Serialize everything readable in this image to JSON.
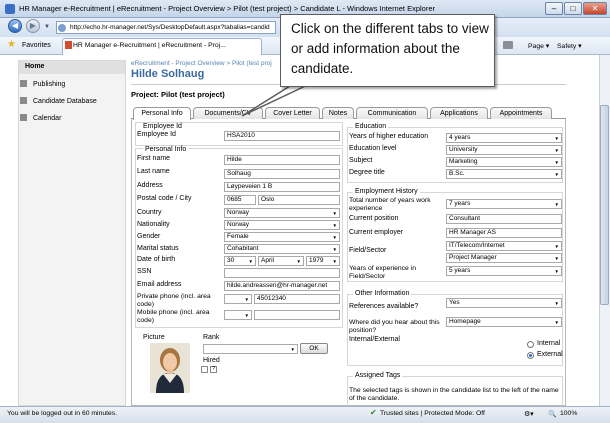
{
  "window": {
    "title": "HR Manager e-Recruitment | eRecruitment - Project Overview > Pilot (test project) > Candidate L - Windows Internet Explorer",
    "minimize": "–",
    "maximize": "□",
    "close": "✕"
  },
  "browser": {
    "url": "http://echo.hr-manager.net/Sys/DesktopDefault.aspx?tabalias=candid",
    "favorites_label": "Favorites",
    "tab_title": "HR Manager e-Recruitment | eRecruitment - Proj...",
    "page_menu": "Page ▾",
    "safety_menu": "Safety ▾"
  },
  "sidebar": {
    "items": [
      {
        "label": "Home"
      },
      {
        "label": "Publishing"
      },
      {
        "label": "Candidate Database"
      },
      {
        "label": "Calendar"
      }
    ]
  },
  "page": {
    "breadcrumb": "eRecruitment - Project Overview > Pilot (test proj",
    "candidate_name": "Hilde Solhaug",
    "project_label": "Project: Pilot (test project)"
  },
  "tabs": [
    {
      "label": "Personal Info",
      "active": true
    },
    {
      "label": "Documents/CV",
      "active": false
    },
    {
      "label": "Cover Letter",
      "active": false
    },
    {
      "label": "Notes",
      "active": false
    },
    {
      "label": "Communication",
      "active": false
    },
    {
      "label": "Applications",
      "active": false
    },
    {
      "label": "Appointments",
      "active": false
    }
  ],
  "form": {
    "employee_id": {
      "section": "Employee Id",
      "label": "Employee Id",
      "value": "HSA2010"
    },
    "personal": {
      "section": "Personal Info",
      "first_name": {
        "label": "First name",
        "value": "Hilde"
      },
      "last_name": {
        "label": "Last name",
        "value": "Solhaug"
      },
      "address": {
        "label": "Address",
        "value": "Løypeveien 1 B"
      },
      "postal": {
        "label": "Postal code / City",
        "code": "0685",
        "city": "Oslo"
      },
      "country": {
        "label": "Country",
        "value": "Norway"
      },
      "nationality": {
        "label": "Nationality",
        "value": "Norway"
      },
      "gender": {
        "label": "Gender",
        "value": "Female"
      },
      "marital": {
        "label": "Marital status",
        "value": "Cohabitant"
      },
      "dob": {
        "label": "Date of birth",
        "day": "30",
        "month": "April",
        "year": "1979"
      },
      "ssn": {
        "label": "SSN",
        "value": ""
      },
      "email": {
        "label": "Email address",
        "value": "hilde.andreassen@hr-manager.net"
      },
      "private_phone": {
        "label": "Private phone (incl. area code)",
        "value": "45012340"
      },
      "mobile_phone": {
        "label": "Mobile phone (incl. area code)",
        "value": ""
      }
    },
    "picture": {
      "label": "Picture",
      "rank_label": "Rank",
      "ok_label": "OK",
      "hired_label": "Hired",
      "help": "?"
    },
    "education": {
      "section": "Education",
      "years": {
        "label": "Years of higher education",
        "value": "4 years"
      },
      "level": {
        "label": "Education level",
        "value": "University"
      },
      "subject": {
        "label": "Subject",
        "value": "Marketing"
      },
      "degree": {
        "label": "Degree title",
        "value": "B.Sc."
      }
    },
    "employment": {
      "section": "Employment History",
      "total_years": {
        "label": "Total number of years work experience",
        "value": "7 years"
      },
      "position": {
        "label": "Current position",
        "value": "Consultant"
      },
      "employer": {
        "label": "Current employer",
        "value": "HR Manager AS"
      },
      "field": {
        "label": "Field/Sector",
        "value1": "IT/Telecom/Internet",
        "value2": "Project Manager"
      },
      "years_field": {
        "label": "Years of experience in Field/Sector",
        "value": "5 years"
      }
    },
    "other": {
      "section": "Other Information",
      "references": {
        "label": "References available?",
        "value": "Yes"
      },
      "heard": {
        "label": "Where did you hear about this position?",
        "value": "Homepage"
      },
      "internal_external": {
        "label": "Internal/External",
        "internal": "Internal",
        "external": "External",
        "selected": "External"
      }
    },
    "tags": {
      "section": "Assigned Tags",
      "description": "The selected tags is shown in the candidate list to the left of the name of the candidate."
    }
  },
  "callout": {
    "text": "Click on the different tabs to view or add information about the candidate."
  },
  "status": {
    "left": "You will be logged out in 60 minutes.",
    "zone": "Trusted sites | Protected Mode: Off",
    "zoom": "100%"
  },
  "colors": {
    "accent": "#3b6aa0",
    "breadcrumb": "#5a7fb4"
  }
}
